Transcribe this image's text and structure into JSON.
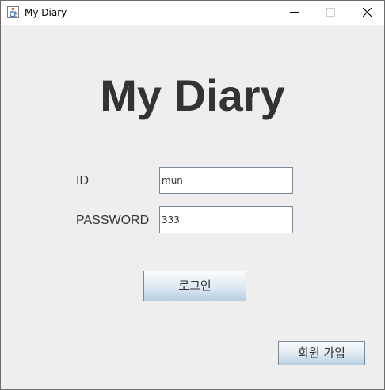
{
  "window": {
    "title": "My Diary",
    "icon": "java-cup-icon",
    "controls": [
      "minimize-icon",
      "maximize-icon",
      "close-icon"
    ]
  },
  "main": {
    "heading": "My Diary",
    "id_label": "ID",
    "id_value": "mun",
    "password_label": "PASSWORD",
    "password_value": "333",
    "login_button": "로그인",
    "signup_button": "회원 가입"
  },
  "colors": {
    "background": "#eeeeee",
    "text": "#333333",
    "field_border": "#7a8a99",
    "button_gradient_top": "#fbfcfd",
    "button_gradient_bottom": "#b8cfe2"
  }
}
